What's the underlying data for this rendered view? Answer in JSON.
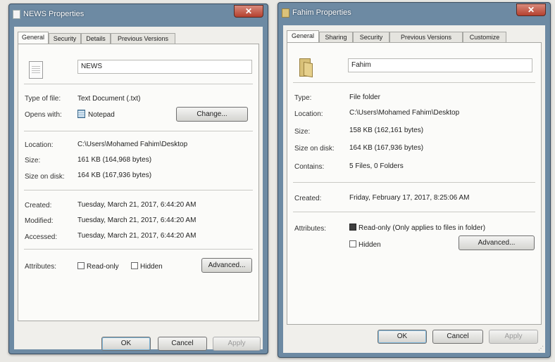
{
  "news_dialog": {
    "title": "NEWS Properties",
    "tabs": [
      "General",
      "Security",
      "Details",
      "Previous Versions"
    ],
    "file_name": "NEWS",
    "type_of_file_label": "Type of file:",
    "type_of_file_value": "Text Document (.txt)",
    "opens_with_label": "Opens with:",
    "opens_with_value": "Notepad",
    "change_button": "Change...",
    "location_label": "Location:",
    "location_value": "C:\\Users\\Mohamed Fahim\\Desktop",
    "size_label": "Size:",
    "size_value": "161 KB (164,968 bytes)",
    "size_on_disk_label": "Size on disk:",
    "size_on_disk_value": "164 KB (167,936 bytes)",
    "created_label": "Created:",
    "created_value": "Tuesday, March 21, 2017, 6:44:20 AM",
    "modified_label": "Modified:",
    "modified_value": "Tuesday, March 21, 2017, 6:44:20 AM",
    "accessed_label": "Accessed:",
    "accessed_value": "Tuesday, March 21, 2017, 6:44:20 AM",
    "attributes_label": "Attributes:",
    "readonly_label": "Read-only",
    "hidden_label": "Hidden",
    "advanced_button": "Advanced...",
    "ok_button": "OK",
    "cancel_button": "Cancel",
    "apply_button": "Apply"
  },
  "fahim_dialog": {
    "title": "Fahim Properties",
    "tabs": [
      "General",
      "Sharing",
      "Security",
      "Previous Versions",
      "Customize"
    ],
    "folder_name": "Fahim",
    "type_label": "Type:",
    "type_value": "File folder",
    "location_label": "Location:",
    "location_value": "C:\\Users\\Mohamed Fahim\\Desktop",
    "size_label": "Size:",
    "size_value": "158 KB (162,161 bytes)",
    "size_on_disk_label": "Size on disk:",
    "size_on_disk_value": "164 KB (167,936 bytes)",
    "contains_label": "Contains:",
    "contains_value": "5 Files, 0 Folders",
    "created_label": "Created:",
    "created_value": "Friday, February 17, 2017, 8:25:06 AM",
    "attributes_label": "Attributes:",
    "readonly_label": "Read-only (Only applies to files in folder)",
    "hidden_label": "Hidden",
    "advanced_button": "Advanced...",
    "ok_button": "OK",
    "cancel_button": "Cancel",
    "apply_button": "Apply"
  },
  "colors": {
    "title_bar": "#6d8aa3",
    "dialog_face": "#f0efeb",
    "close_button": "#b5412f"
  }
}
